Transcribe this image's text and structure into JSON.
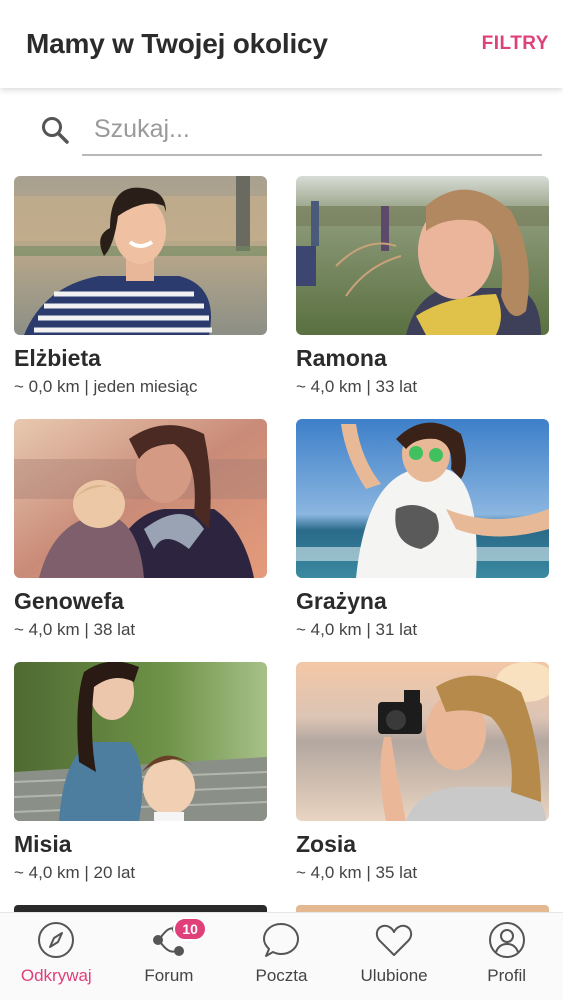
{
  "header": {
    "title": "Mamy w Twojej okolicy",
    "filter_label": "FILTRY"
  },
  "search": {
    "placeholder": "Szukaj...",
    "value": ""
  },
  "profiles": [
    {
      "name": "Elżbieta",
      "meta": "~ 0,0 km | jeden miesiąc"
    },
    {
      "name": "Ramona",
      "meta": "~ 4,0 km | 33 lat"
    },
    {
      "name": "Genowefa",
      "meta": "~ 4,0 km | 38 lat"
    },
    {
      "name": "Grażyna",
      "meta": "~ 4,0 km | 31 lat"
    },
    {
      "name": "Misia",
      "meta": "~ 4,0 km | 20 lat"
    },
    {
      "name": "Zosia",
      "meta": "~ 4,0 km | 35 lat"
    }
  ],
  "tabbar": {
    "tabs": [
      {
        "label": "Odkrywaj",
        "icon": "compass-icon",
        "active": true
      },
      {
        "label": "Forum",
        "icon": "forum-icon",
        "badge": "10"
      },
      {
        "label": "Poczta",
        "icon": "chat-bubble-icon"
      },
      {
        "label": "Ulubione",
        "icon": "heart-icon"
      },
      {
        "label": "Profil",
        "icon": "profile-icon"
      }
    ]
  },
  "colors": {
    "accent": "#e0407a",
    "text": "#2b2b2b",
    "muted": "#9a9a9a"
  }
}
